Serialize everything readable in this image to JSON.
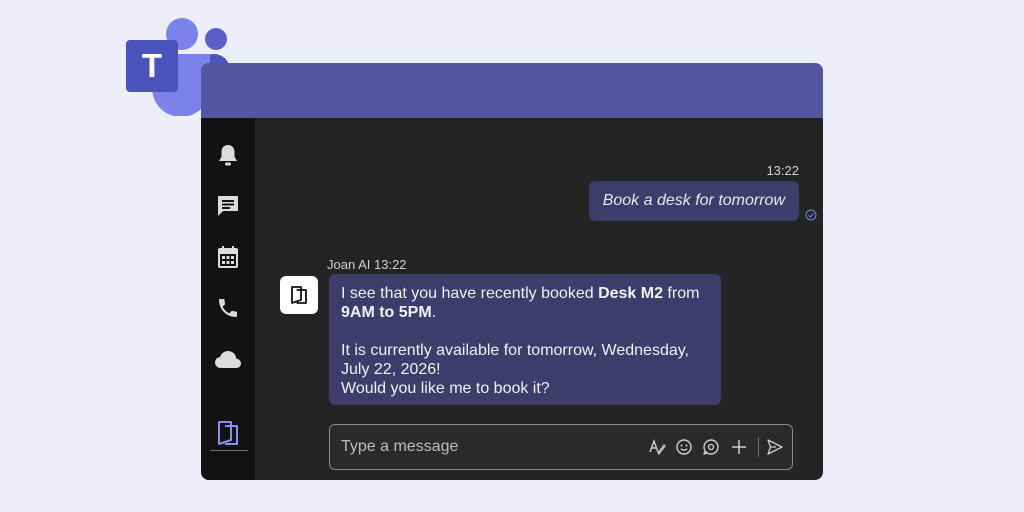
{
  "app": {
    "logo_letter": "T",
    "brand_color": "#5258A0"
  },
  "sidebar": {
    "items": [
      {
        "icon": "bell-icon",
        "label": "Activity"
      },
      {
        "icon": "chat-icon",
        "label": "Chat"
      },
      {
        "icon": "calendar-icon",
        "label": "Calendar"
      },
      {
        "icon": "phone-icon",
        "label": "Calls"
      },
      {
        "icon": "cloud-icon",
        "label": "Files"
      },
      {
        "icon": "joan-app-icon",
        "label": "Joan"
      }
    ]
  },
  "chat": {
    "outgoing": {
      "time": "13:22",
      "text": "Book a desk for tomorrow"
    },
    "incoming": {
      "sender": "Joan AI",
      "time": "13:22",
      "line1_pre": "I see that you have recently booked ",
      "line1_bold": "Desk M2",
      "line1_post": " from",
      "line2_bold": "9AM to 5PM",
      "line2_post": ".",
      "line3": "It is currently available for tomorrow, Wednesday,",
      "line4": "July 22, 2026!",
      "line5": "Would you like me to book it?"
    }
  },
  "composer": {
    "placeholder": "Type a message",
    "icons": [
      "format-icon",
      "emoji-icon",
      "sticker-icon",
      "plus-icon",
      "send-icon"
    ]
  },
  "colors": {
    "bubble": "#3D3C6B",
    "window_bg": "#242424",
    "rail_bg": "#121212",
    "page_bg": "#EEEEFB"
  }
}
